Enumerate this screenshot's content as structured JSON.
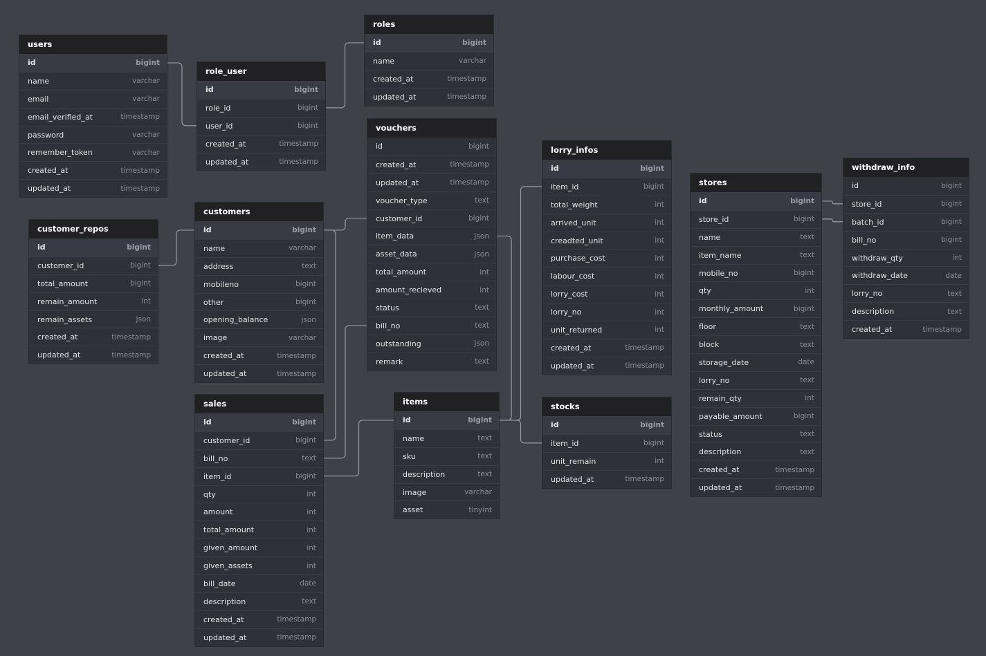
{
  "colors": {
    "background": "#404049",
    "header": "#212124",
    "body": "#303038",
    "link": "#9a9aa3"
  },
  "tables": [
    {
      "name": "users",
      "fields": [
        {
          "name": "id",
          "type": "bigint",
          "pk": true
        },
        {
          "name": "name",
          "type": "varchar"
        },
        {
          "name": "email",
          "type": "varchar"
        },
        {
          "name": "email_verified_at",
          "type": "timestamp"
        },
        {
          "name": "password",
          "type": "varchar"
        },
        {
          "name": "remember_token",
          "type": "varchar"
        },
        {
          "name": "created_at",
          "type": "timestamp"
        },
        {
          "name": "updated_at",
          "type": "timestamp"
        }
      ]
    },
    {
      "name": "role_user",
      "fields": [
        {
          "name": "id",
          "type": "bigint",
          "pk": true
        },
        {
          "name": "role_id",
          "type": "bigint"
        },
        {
          "name": "user_id",
          "type": "bigint"
        },
        {
          "name": "created_at",
          "type": "timestamp"
        },
        {
          "name": "updated_at",
          "type": "timestamp"
        }
      ]
    },
    {
      "name": "roles",
      "fields": [
        {
          "name": "id",
          "type": "bigint",
          "pk": true
        },
        {
          "name": "name",
          "type": "varchar"
        },
        {
          "name": "created_at",
          "type": "timestamp"
        },
        {
          "name": "updated_at",
          "type": "timestamp"
        }
      ]
    },
    {
      "name": "vouchers",
      "fields": [
        {
          "name": "id",
          "type": "bigint"
        },
        {
          "name": "created_at",
          "type": "timestamp"
        },
        {
          "name": "updated_at",
          "type": "timestamp"
        },
        {
          "name": "voucher_type",
          "type": "text"
        },
        {
          "name": "customer_id",
          "type": "bigint"
        },
        {
          "name": "item_data",
          "type": "json"
        },
        {
          "name": "asset_data",
          "type": "json"
        },
        {
          "name": "total_amount",
          "type": "int"
        },
        {
          "name": "amount_recieved",
          "type": "int"
        },
        {
          "name": "status",
          "type": "text"
        },
        {
          "name": "bill_no",
          "type": "text"
        },
        {
          "name": "outstanding",
          "type": "json"
        },
        {
          "name": "remark",
          "type": "text"
        }
      ]
    },
    {
      "name": "lorry_infos",
      "fields": [
        {
          "name": "id",
          "type": "bigint",
          "pk": true
        },
        {
          "name": "item_id",
          "type": "bigint"
        },
        {
          "name": "total_weight",
          "type": "int"
        },
        {
          "name": "arrived_unit",
          "type": "int"
        },
        {
          "name": "creadted_unit",
          "type": "int"
        },
        {
          "name": "purchase_cost",
          "type": "int"
        },
        {
          "name": "labour_cost",
          "type": "int"
        },
        {
          "name": "lorry_cost",
          "type": "int"
        },
        {
          "name": "lorry_no",
          "type": "int"
        },
        {
          "name": "unit_returned",
          "type": "int"
        },
        {
          "name": "created_at",
          "type": "timestamp"
        },
        {
          "name": "updated_at",
          "type": "timestamp"
        }
      ]
    },
    {
      "name": "stores",
      "fields": [
        {
          "name": "id",
          "type": "bigint",
          "pk": true
        },
        {
          "name": "store_id",
          "type": "bigint"
        },
        {
          "name": "name",
          "type": "text"
        },
        {
          "name": "item_name",
          "type": "text"
        },
        {
          "name": "mobile_no",
          "type": "bigint"
        },
        {
          "name": "qty",
          "type": "int"
        },
        {
          "name": "monthly_amount",
          "type": "bigint"
        },
        {
          "name": "floor",
          "type": "text"
        },
        {
          "name": "block",
          "type": "text"
        },
        {
          "name": "storage_date",
          "type": "date"
        },
        {
          "name": "lorry_no",
          "type": "text"
        },
        {
          "name": "remain_qty",
          "type": "int"
        },
        {
          "name": "payable_amount",
          "type": "bigint"
        },
        {
          "name": "status",
          "type": "text"
        },
        {
          "name": "description",
          "type": "text"
        },
        {
          "name": "created_at",
          "type": "timestamp"
        },
        {
          "name": "updated_at",
          "type": "timestamp"
        }
      ]
    },
    {
      "name": "withdraw_info",
      "fields": [
        {
          "name": "id",
          "type": "bigint"
        },
        {
          "name": "store_id",
          "type": "bigint"
        },
        {
          "name": "batch_id",
          "type": "bigint"
        },
        {
          "name": "bill_no",
          "type": "bigint"
        },
        {
          "name": "withdraw_qty",
          "type": "int"
        },
        {
          "name": "withdraw_date",
          "type": "date"
        },
        {
          "name": "lorry_no",
          "type": "text"
        },
        {
          "name": "description",
          "type": "text"
        },
        {
          "name": "created_at",
          "type": "timestamp"
        }
      ]
    },
    {
      "name": "customer_repos",
      "fields": [
        {
          "name": "id",
          "type": "bigint",
          "pk": true
        },
        {
          "name": "customer_id",
          "type": "bigint"
        },
        {
          "name": "total_amount",
          "type": "bigint"
        },
        {
          "name": "remain_amount",
          "type": "int"
        },
        {
          "name": "remain_assets",
          "type": "json"
        },
        {
          "name": "created_at",
          "type": "timestamp"
        },
        {
          "name": "updated_at",
          "type": "timestamp"
        }
      ]
    },
    {
      "name": "customers",
      "fields": [
        {
          "name": "id",
          "type": "bigint",
          "pk": true
        },
        {
          "name": "name",
          "type": "varchar"
        },
        {
          "name": "address",
          "type": "text"
        },
        {
          "name": "mobileno",
          "type": "bigint"
        },
        {
          "name": "other",
          "type": "bigint"
        },
        {
          "name": "opening_balance",
          "type": "json"
        },
        {
          "name": "image",
          "type": "varchar"
        },
        {
          "name": "created_at",
          "type": "timestamp"
        },
        {
          "name": "updated_at",
          "type": "timestamp"
        }
      ]
    },
    {
      "name": "sales",
      "fields": [
        {
          "name": "id",
          "type": "bigint",
          "pk": true
        },
        {
          "name": "customer_id",
          "type": "bigint"
        },
        {
          "name": "bill_no",
          "type": "text"
        },
        {
          "name": "item_id",
          "type": "bigint"
        },
        {
          "name": "qty",
          "type": "int"
        },
        {
          "name": "amount",
          "type": "int"
        },
        {
          "name": "total_amount",
          "type": "int"
        },
        {
          "name": "given_amount",
          "type": "int"
        },
        {
          "name": "given_assets",
          "type": "int"
        },
        {
          "name": "bill_date",
          "type": "date"
        },
        {
          "name": "description",
          "type": "text"
        },
        {
          "name": "created_at",
          "type": "timestamp"
        },
        {
          "name": "updated_at",
          "type": "timestamp"
        }
      ]
    },
    {
      "name": "items",
      "fields": [
        {
          "name": "id",
          "type": "bigint",
          "pk": true
        },
        {
          "name": "name",
          "type": "text"
        },
        {
          "name": "sku",
          "type": "text"
        },
        {
          "name": "description",
          "type": "text"
        },
        {
          "name": "image",
          "type": "varchar"
        },
        {
          "name": "asset",
          "type": "tinyint"
        }
      ]
    },
    {
      "name": "stocks",
      "fields": [
        {
          "name": "id",
          "type": "bigint",
          "pk": true
        },
        {
          "name": "item_id",
          "type": "bigint"
        },
        {
          "name": "unit_remain",
          "type": "int"
        },
        {
          "name": "updated_at",
          "type": "timestamp"
        }
      ]
    }
  ],
  "relations": [
    {
      "from": "users.id",
      "to": "role_user.user_id"
    },
    {
      "from": "roles.id",
      "to": "role_user.role_id"
    },
    {
      "from": "customers.id",
      "to": "customer_repos.customer_id"
    },
    {
      "from": "customers.id",
      "to": "vouchers.customer_id"
    },
    {
      "from": "customers.id",
      "to": "sales.customer_id"
    },
    {
      "from": "vouchers.bill_no",
      "to": "sales.bill_no"
    },
    {
      "from": "items.id",
      "to": "sales.item_id"
    },
    {
      "from": "items.id",
      "to": "vouchers.item_data"
    },
    {
      "from": "items.id",
      "to": "lorry_infos.item_id"
    },
    {
      "from": "items.id",
      "to": "stocks.item_id"
    },
    {
      "from": "stores.id",
      "to": "withdraw_info.store_id"
    },
    {
      "from": "stores.store_id",
      "to": "withdraw_info.batch_id"
    }
  ]
}
